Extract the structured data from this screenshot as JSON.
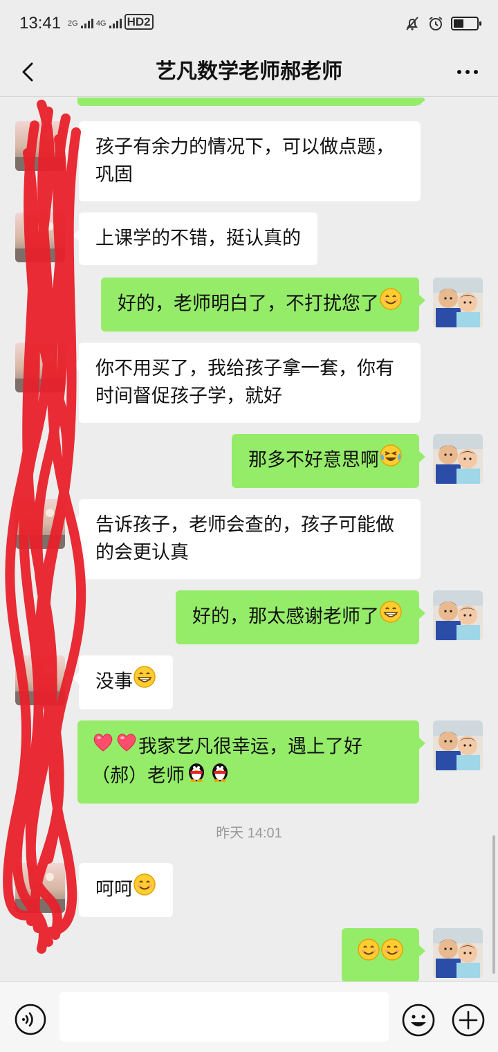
{
  "status": {
    "time": "13:41",
    "net_left": "2G",
    "net_right": "4G",
    "hd": "HD2",
    "battery_level": 0.45
  },
  "header": {
    "title": "艺凡数学老师郝老师"
  },
  "messages": [
    {
      "from": "teacher",
      "text": "孩子有余力的情况下，可以做点题，巩固"
    },
    {
      "from": "teacher",
      "text": "上课学的不错，挺认真的"
    },
    {
      "from": "me",
      "text": "好的，老师明白了，不打扰您了",
      "emoji": [
        "smile"
      ]
    },
    {
      "from": "teacher",
      "text": "你不用买了，我给孩子拿一套，你有时间督促孩子学，就好"
    },
    {
      "from": "me",
      "text": "那多不好意思啊",
      "emoji": [
        "laugh-cry"
      ]
    },
    {
      "from": "teacher",
      "text": "告诉孩子，老师会查的，孩子可能做的会更认真"
    },
    {
      "from": "me",
      "text": "好的，那太感谢老师了",
      "emoji": [
        "grin"
      ]
    },
    {
      "from": "teacher",
      "text": "没事",
      "emoji": [
        "grin"
      ]
    },
    {
      "from": "me",
      "text_a": "我家艺凡很幸运，遇上了好",
      "text_b": "（郝）老师",
      "emoji_prefix": [
        "heart",
        "heart"
      ],
      "emoji_suffix": [
        "penguin",
        "penguin"
      ]
    },
    {
      "from": "teacher",
      "text": "呵呵",
      "emoji": [
        "smile"
      ]
    },
    {
      "from": "me",
      "text": "",
      "emoji": [
        "smile",
        "smile"
      ]
    }
  ],
  "timestamp": "昨天 14:01",
  "input": {
    "placeholder": "",
    "value": ""
  },
  "icons": {
    "back": "back-arrow-icon",
    "more": "more-dots-icon",
    "voice": "voice-icon",
    "emoji": "emoji-icon",
    "plus": "plus-icon"
  },
  "colors": {
    "outgoing_bubble": "#95ec69",
    "incoming_bubble": "#ffffff",
    "background": "#ededed",
    "scribble": "#e8212b"
  }
}
